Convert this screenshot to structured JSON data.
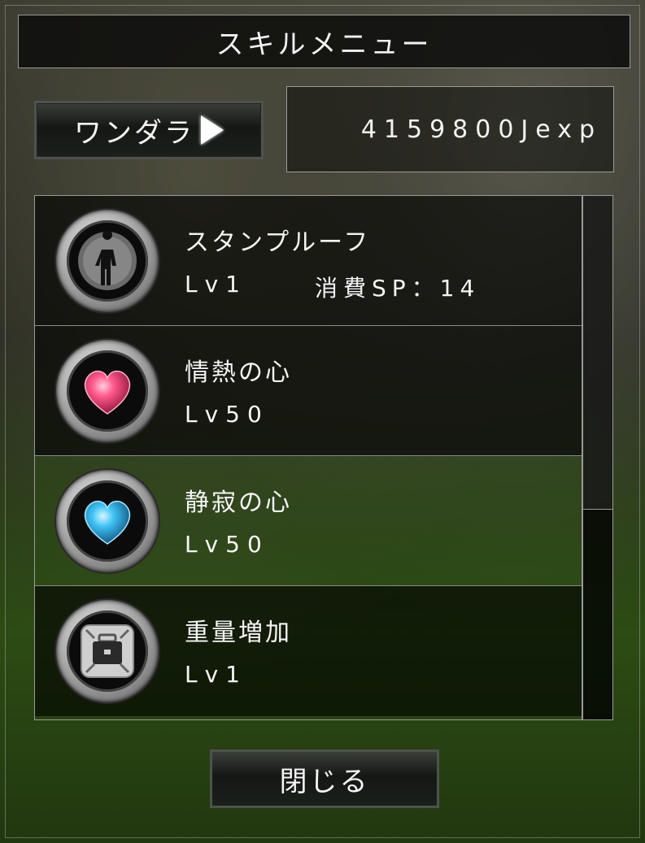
{
  "title": "スキルメニュー",
  "job_button": {
    "label": "ワンダラ"
  },
  "experience": "4159800Jexp",
  "skills": [
    {
      "name": "スタンプルーフ",
      "level": "Lv1",
      "cost": "消費SP：14",
      "icon": "figure-icon"
    },
    {
      "name": "情熱の心",
      "level": "Lv50",
      "cost": "",
      "icon": "pink-heart-icon"
    },
    {
      "name": "静寂の心",
      "level": "Lv50",
      "cost": "",
      "icon": "blue-heart-icon"
    },
    {
      "name": "重量増加",
      "level": "Lv1",
      "cost": "",
      "icon": "briefcase-icon"
    }
  ],
  "close_button": {
    "label": "閉じる"
  },
  "colors": {
    "text": "#f5f5f5",
    "pink_heart": "#e8356e",
    "blue_heart": "#35b8ee",
    "frame": "#9a9a9a"
  }
}
